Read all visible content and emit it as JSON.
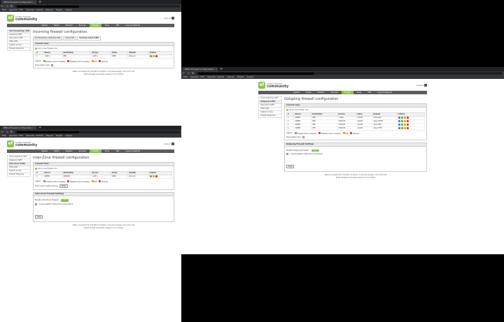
{
  "browser": {
    "tab_title": "IPFire Firewall Configuration",
    "tab_close": "×",
    "tab_new": "+",
    "nav_back": "←",
    "nav_forward": "→",
    "nav_reload": "↻",
    "bookmarks": [
      "EFW",
      "OpenVAS - EFW",
      "OpenVAS - RADIUS",
      "pfSense",
      "Edge01",
      "Sophos"
    ]
  },
  "app": {
    "logo_small": "endian firewall",
    "logo_big": "community",
    "logout": "Logout"
  },
  "menu": [
    "System",
    "Status",
    "Network",
    "Services",
    "Firewall",
    "Proxy",
    "VPN",
    "Logs and Reports"
  ],
  "sidebar": [
    "Port forwarding / NAT",
    "Outgoing traffic",
    "Inter-Zone traffic",
    "VPN traffic",
    "System access",
    "Firewall Diagrams"
  ],
  "windows": {
    "incoming": {
      "title": "Incoming firewall configuration",
      "subtabs": [
        "Port forwarding / Destination NAT",
        "Source NAT",
        "Incoming routed traffic"
      ],
      "section": "Current rules",
      "add": "Add a new firewall rule",
      "headers": [
        "#",
        "Source",
        "Destination",
        "Service",
        "Policy",
        "Remark",
        "Actions"
      ],
      "rows": [
        {
          "n": "1",
          "src": "<ANY>",
          "dst": "RED",
          "svc": "<ANY>",
          "pol": "DENY",
          "rem": "Deny all"
        }
      ],
      "legend": [
        "Legend:",
        "Enabled (click to disable)",
        "Disabled (click to enable)",
        "Edit",
        "Remove"
      ],
      "show_rules": "Show system rules",
      "footer_status": "Status: Connected (IP: 192.168.1.1)  Uptime: 1:02  Load average: 0.01, 0.05, 0.02",
      "footer_copy": "Endian Firewall Community release 3.3.2 (c) Endian"
    },
    "interzone": {
      "title": "Inter-Zone firewall configuration",
      "section": "Current rules",
      "add": "Add a new firewall rule",
      "headers": [
        "#",
        "Source",
        "Destination",
        "Service",
        "Policy",
        "Remark",
        "Actions"
      ],
      "rows": [
        {
          "n": "1",
          "src": "GREEN",
          "dst": "ORANGE",
          "svc": "<ANY>",
          "pol": "DENY",
          "rem": "Deny all"
        }
      ],
      "legend": [
        "Legend:",
        "Enabled (click to disable)",
        "Disabled (click to enable)",
        "Edit",
        "Remove"
      ],
      "show_rules": "Show rules of system services",
      "show_btn": "Show",
      "settings_head": "Inter-Zone Firewall Settings",
      "setting_label": "Enable Inter-Zone firewall:",
      "setting_value": "ON",
      "log_label": "Log accepted Inter-Zone connections",
      "save": "Save",
      "footer_status": "Status: Connected (IP: 192.168.1.1)  Uptime: 1:02  Load average: 0.01, 0.05, 0.02",
      "footer_copy": "Endian Firewall Community release 3.3.2 (c) Endian"
    },
    "outgoing": {
      "title": "Outgoing firewall configuration",
      "section": "Current rules",
      "add": "Add a new firewall rule",
      "headers": [
        "#",
        "Source",
        "Destination",
        "Service",
        "Policy",
        "Remark",
        "Actions"
      ],
      "rows": [
        {
          "n": "1",
          "src": "GREEN",
          "dst": "RED",
          "svc": "<ANY>",
          "pol": "ALLOW",
          "rem": "Allow web"
        },
        {
          "n": "2",
          "src": "GREEN",
          "dst": "RED",
          "svc": "TCP/UDP",
          "pol": "ALLOW",
          "rem": "allow HTTPS"
        },
        {
          "n": "3",
          "src": "GREEN",
          "dst": "RED",
          "svc": "TCP/UDP",
          "pol": "ALLOW",
          "rem": "allow DNS"
        },
        {
          "n": "4",
          "src": "GREEN",
          "dst": "RED",
          "svc": "TCP/UDP",
          "pol": "ALLOW",
          "rem": "allow HTTP"
        }
      ],
      "legend": [
        "Legend:",
        "Enabled (click to disable)",
        "Disabled (click to enable)",
        "Edit",
        "Remove"
      ],
      "show_rules": "Show system rules",
      "settings_head": "Outgoing Firewall Settings",
      "setting_label": "Enable Outgoing firewall:",
      "setting_value": "ON",
      "log_label": "Log accepted outgoing connections",
      "save": "Save",
      "footer_status": "Status: Connected (IP: 192.168.1.1)  Uptime: 1:02  Load average: 0.01, 0.05, 0.02",
      "footer_copy": "Endian Firewall Community release 3.3.2 (c) Endian"
    }
  }
}
